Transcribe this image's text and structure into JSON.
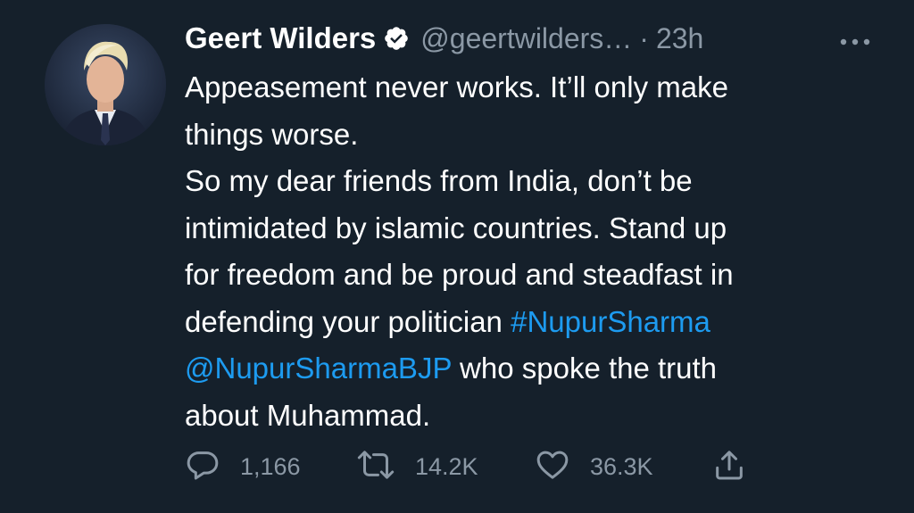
{
  "tweet": {
    "author": {
      "display_name": "Geert Wilders",
      "handle": "@geertwilders…",
      "verified": true
    },
    "separator": "·",
    "time": "23h",
    "body_lines": [
      [
        {
          "text": "Appeasement never works. It’ll only make",
          "link": false
        }
      ],
      [
        {
          "text": "things worse.",
          "link": false
        }
      ],
      [
        {
          "text": "So my dear friends from India, don’t be",
          "link": false
        }
      ],
      [
        {
          "text": "intimidated by islamic countries. Stand up",
          "link": false
        }
      ],
      [
        {
          "text": "for freedom and be proud and steadfast in",
          "link": false
        }
      ],
      [
        {
          "text": "defending your politician ",
          "link": false
        },
        {
          "text": "#NupurSharma",
          "link": true
        }
      ],
      [
        {
          "text": "@NupurSharmaBJP",
          "link": true
        },
        {
          "text": " who spoke the truth",
          "link": false
        }
      ],
      [
        {
          "text": "about Muhammad.",
          "link": false
        }
      ]
    ],
    "stats": {
      "replies": "1,166",
      "retweets": "14.2K",
      "likes": "36.3K"
    }
  },
  "colors": {
    "background": "#15202b",
    "text": "#ffffff",
    "secondary": "#8b98a5",
    "link": "#1d9bf0"
  },
  "icons": {
    "more": "more-horizontal-icon",
    "reply": "reply-bubble-icon",
    "retweet": "retweet-arrows-icon",
    "like": "heart-outline-icon",
    "share": "share-upload-icon",
    "verified": "verified-badge-icon"
  }
}
